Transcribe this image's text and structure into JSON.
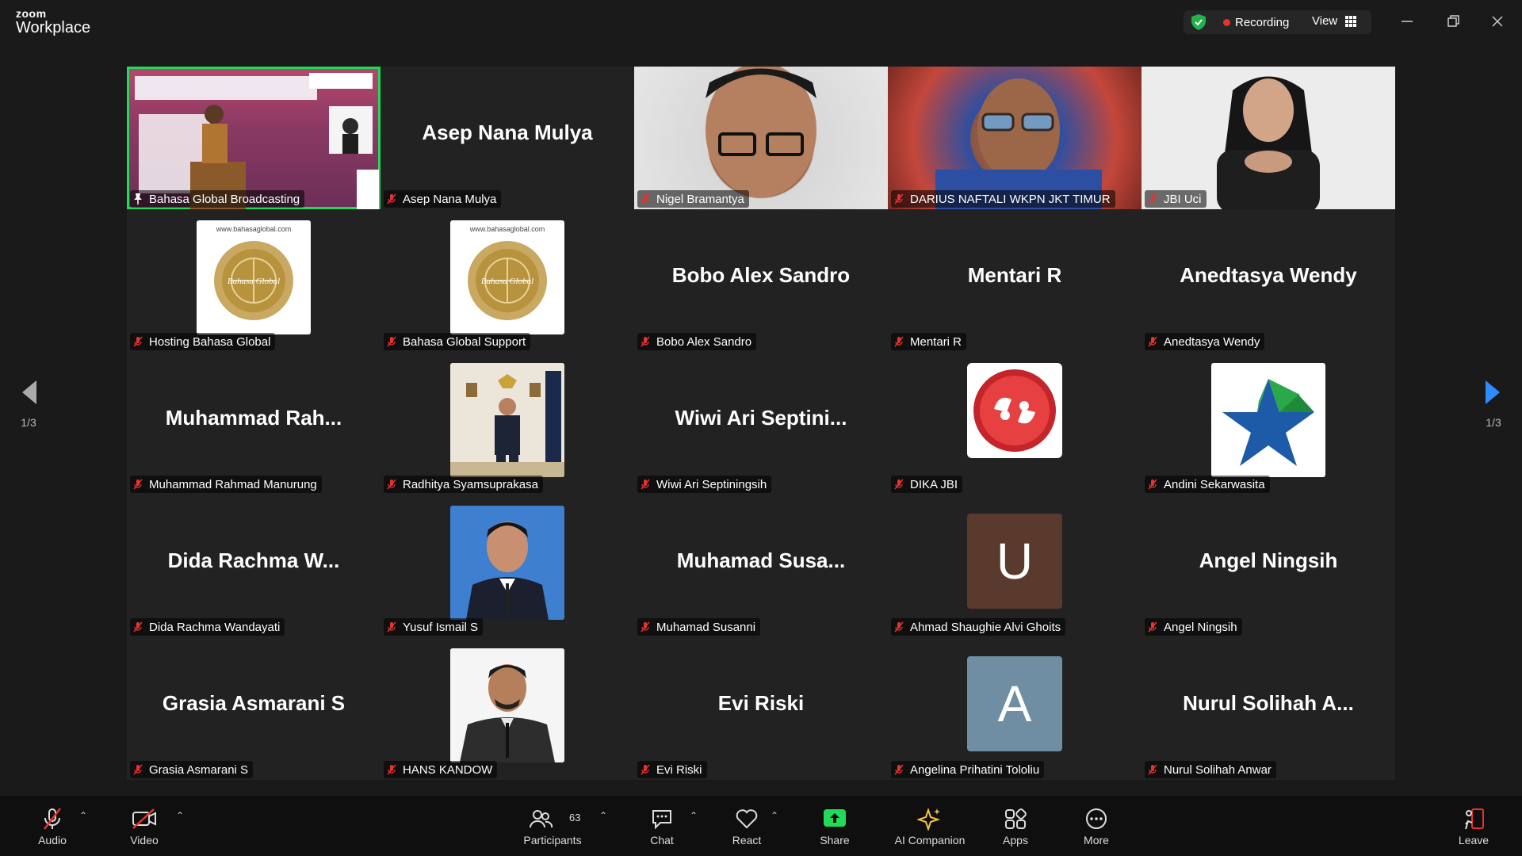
{
  "app": {
    "logo_top": "zoom",
    "logo_bottom": "Workplace"
  },
  "header": {
    "recording_label": "Recording",
    "view_label": "View"
  },
  "pagination": {
    "left": "1/3",
    "right": "1/3"
  },
  "tiles": [
    {
      "name": "Bahasa Global Broadcasting"
    },
    {
      "name": "Asep Nana Mulya",
      "display": "Asep Nana Mulya"
    },
    {
      "name": "Nigel Bramantya"
    },
    {
      "name": "DARIUS NAFTALI WKPN JKT TIMUR"
    },
    {
      "name": "JBI Uci"
    },
    {
      "name": "Hosting Bahasa Global",
      "logo_text": "www.bahasaglobal.com",
      "seal_text": "Bahasa Global"
    },
    {
      "name": "Bahasa Global Support",
      "logo_text": "www.bahasaglobal.com",
      "seal_text": "Bahasa Global"
    },
    {
      "name": "Bobo Alex Sandro",
      "display": "Bobo Alex Sandro"
    },
    {
      "name": "Mentari R",
      "display": "Mentari R"
    },
    {
      "name": "Anedtasya Wendy",
      "display": "Anedtasya Wendy"
    },
    {
      "name": "Muhammad Rahmad Manurung",
      "display": "Muhammad Rah..."
    },
    {
      "name": "Radhitya Syamsuprakasa"
    },
    {
      "name": "Wiwi Ari Septiningsih",
      "display": "Wiwi Ari Septini..."
    },
    {
      "name": "DIKA JBI"
    },
    {
      "name": "Andini Sekarwasita"
    },
    {
      "name": "Dida Rachma Wandayati",
      "display": "Dida Rachma W..."
    },
    {
      "name": "Yusuf Ismail S"
    },
    {
      "name": "Muhamad Susanni",
      "display": "Muhamad Susa..."
    },
    {
      "name": "Ahmad Shaughie Alvi Ghoits",
      "letter": "U"
    },
    {
      "name": "Angel Ningsih",
      "display": "Angel Ningsih"
    },
    {
      "name": "Grasia Asmarani S",
      "display": "Grasia Asmarani S"
    },
    {
      "name": "HANS KANDOW"
    },
    {
      "name": "Evi Riski",
      "display": "Evi Riski"
    },
    {
      "name": "Angelina Prihatini Tololiu",
      "letter": "A"
    },
    {
      "name": "Nurul Solihah Anwar",
      "display": "Nurul Solihah A..."
    }
  ],
  "toolbar": {
    "audio": "Audio",
    "video": "Video",
    "participants": "Participants",
    "participants_count": "63",
    "chat": "Chat",
    "react": "React",
    "share": "Share",
    "ai_companion": "AI Companion",
    "apps": "Apps",
    "more": "More",
    "leave": "Leave"
  },
  "colors": {
    "active_speaker": "#23d959",
    "recording_dot": "#e8322e",
    "share_green": "#23d959",
    "leave_red": "#e8322e",
    "avatar_u": "#5a3a2c",
    "avatar_a": "#6f8ea3"
  }
}
